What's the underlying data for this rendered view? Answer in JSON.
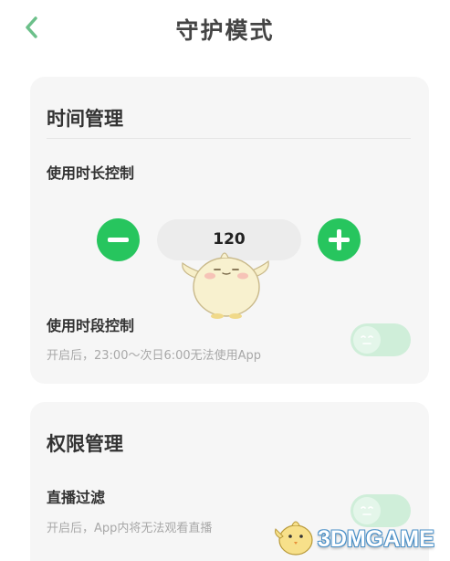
{
  "header": {
    "title": "守护模式"
  },
  "time_section": {
    "title": "时间管理",
    "duration_control": {
      "label": "使用时长控制",
      "value": "120"
    },
    "period_control": {
      "label": "使用时段控制",
      "description": "开启后，23:00～次日6:00无法使用App",
      "enabled": false
    }
  },
  "permission_section": {
    "title": "权限管理",
    "live_filter": {
      "label": "直播过滤",
      "description": "开启后，App内将无法观看直播",
      "enabled": false
    }
  },
  "watermark": {
    "text": "3DMGAME"
  },
  "colors": {
    "accent": "#27c55e",
    "back_arrow": "#6cc08a",
    "toggle_off": "#cfeed9",
    "card_bg": "#f6f6f6"
  }
}
